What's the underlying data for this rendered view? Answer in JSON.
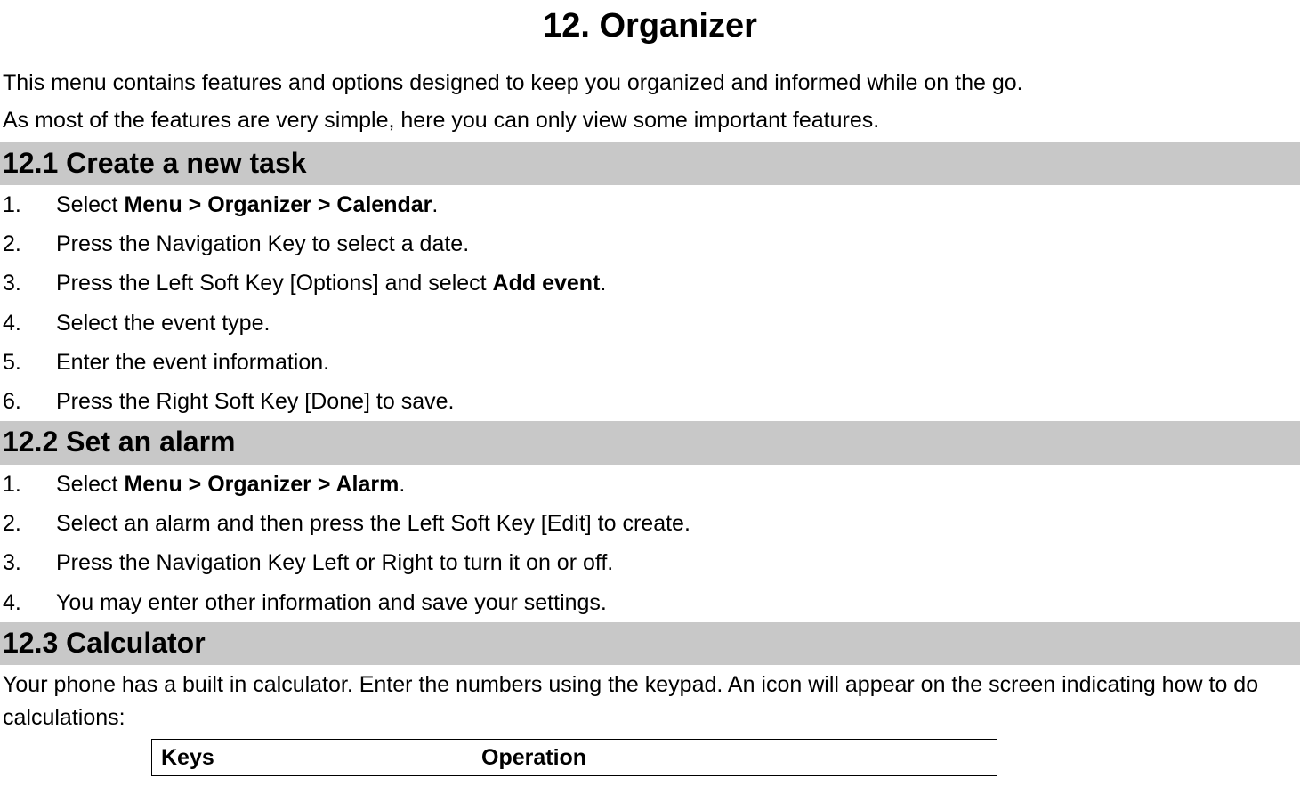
{
  "page_title": "12. Organizer",
  "intro_paragraphs": [
    "This menu contains features and options designed to keep you organized and informed while on the go.",
    "As most of the features are very simple, here you can only view some important features."
  ],
  "sections": {
    "s1": {
      "heading": "12.1  Create a new task",
      "steps": [
        {
          "pre": "Select ",
          "bold": "Menu > Organizer > Calendar",
          "post": "."
        },
        {
          "pre": "Press the Navigation Key to select a date.",
          "bold": "",
          "post": ""
        },
        {
          "pre": "Press the Left Soft Key [Options] and select ",
          "bold": "Add event",
          "post": "."
        },
        {
          "pre": "Select the event type.",
          "bold": "",
          "post": ""
        },
        {
          "pre": "Enter the event information.",
          "bold": "",
          "post": ""
        },
        {
          "pre": "Press the Right Soft Key [Done] to save.",
          "bold": "",
          "post": ""
        }
      ]
    },
    "s2": {
      "heading": "12.2  Set an alarm",
      "steps": [
        {
          "pre": "Select ",
          "bold": "Menu > Organizer > Alarm",
          "post": "."
        },
        {
          "pre": "Select an alarm and then press the Left Soft Key [Edit] to create.",
          "bold": "",
          "post": ""
        },
        {
          "pre": "Press the Navigation Key Left or Right to turn it on or off.",
          "bold": "",
          "post": ""
        },
        {
          "pre": "You may enter other information and save your settings.",
          "bold": "",
          "post": ""
        }
      ]
    },
    "s3": {
      "heading": "12.3  Calculator",
      "body": "Your phone has a built in calculator. Enter the numbers using the keypad. An icon will appear on the screen indicating how to do calculations:",
      "table_headers": {
        "keys": "Keys",
        "operation": "Operation"
      }
    }
  }
}
